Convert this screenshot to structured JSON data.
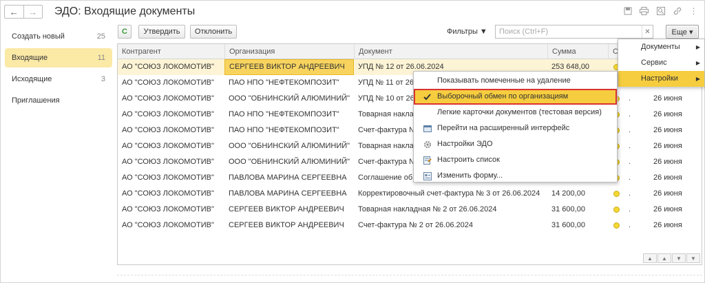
{
  "header": {
    "title": "ЭДО: Входящие документы",
    "back": "←",
    "forward": "→"
  },
  "sidebar": {
    "items": [
      {
        "label": "Создать новый",
        "count": "25"
      },
      {
        "label": "Входящие",
        "count": "11"
      },
      {
        "label": "Исходящие",
        "count": "3"
      },
      {
        "label": "Приглашения",
        "count": ""
      }
    ]
  },
  "toolbar": {
    "refresh": "C",
    "approve": "Утвердить",
    "reject": "Отклонить",
    "filters": "Фильтры ▼",
    "search_placeholder": "Поиск (Ctrl+F)",
    "more": "Еще ▾"
  },
  "table": {
    "columns": [
      "Контрагент",
      "Организация",
      "Документ",
      "Сумма",
      "С"
    ],
    "rows": [
      {
        "contractor": "АО \"СОЮЗ ЛОКОМОТИВ\"",
        "org": "СЕРГЕЕВ ВИКТОР АНДРЕЕВИЧ",
        "doc": "УПД № 12 от 26.06.2024",
        "sum": "253 648,00",
        "date": ""
      },
      {
        "contractor": "АО \"СОЮЗ ЛОКОМОТИВ\"",
        "org": "ПАО НПО \"НЕФТЕКОМПОЗИТ\"",
        "doc": "УПД № 11 от 26.06.2024",
        "sum": "",
        "date": ""
      },
      {
        "contractor": "АО \"СОЮЗ ЛОКОМОТИВ\"",
        "org": "ООО \"ОБНИНСКИЙ АЛЮМИНИЙ\"",
        "doc": "УПД № 10 от 26.06.2024",
        "sum": "",
        "date": "26 июня"
      },
      {
        "contractor": "АО \"СОЮЗ ЛОКОМОТИВ\"",
        "org": "ПАО НПО \"НЕФТЕКОМПОЗИТ\"",
        "doc": "Товарная накладная",
        "sum": "",
        "date": "26 июня"
      },
      {
        "contractor": "АО \"СОЮЗ ЛОКОМОТИВ\"",
        "org": "ПАО НПО \"НЕФТЕКОМПОЗИТ\"",
        "doc": "Счет-фактура № 5",
        "sum": "",
        "date": "26 июня"
      },
      {
        "contractor": "АО \"СОЮЗ ЛОКОМОТИВ\"",
        "org": "ООО \"ОБНИНСКИЙ АЛЮМИНИЙ\"",
        "doc": "Товарная накладная",
        "sum": "",
        "date": "26 июня"
      },
      {
        "contractor": "АО \"СОЮЗ ЛОКОМОТИВ\"",
        "org": "ООО \"ОБНИНСКИЙ АЛЮМИНИЙ\"",
        "doc": "Счет-фактура № 4",
        "sum": "",
        "date": "26 июня"
      },
      {
        "contractor": "АО \"СОЮЗ ЛОКОМОТИВ\"",
        "org": "ПАВЛОВА МАРИНА СЕРГЕЕВНА",
        "doc": "Соглашение об изменении",
        "sum": "",
        "date": "26 июня"
      },
      {
        "contractor": "АО \"СОЮЗ ЛОКОМОТИВ\"",
        "org": "ПАВЛОВА МАРИНА СЕРГЕЕВНА",
        "doc": "Корректировочный счет-фактура № 3 от 26.06.2024",
        "sum": "14 200,00",
        "date": "26 июня"
      },
      {
        "contractor": "АО \"СОЮЗ ЛОКОМОТИВ\"",
        "org": "СЕРГЕЕВ ВИКТОР АНДРЕЕВИЧ",
        "doc": "Товарная накладная № 2 от 26.06.2024",
        "sum": "31 600,00",
        "date": "26 июня"
      },
      {
        "contractor": "АО \"СОЮЗ ЛОКОМОТИВ\"",
        "org": "СЕРГЕЕВ ВИКТОР АНДРЕЕВИЧ",
        "doc": "Счет-фактура № 2 от 26.06.2024",
        "sum": "31 600,00",
        "date": "26 июня"
      }
    ]
  },
  "menu_more": {
    "items": [
      {
        "label": "Документы"
      },
      {
        "label": "Сервис"
      },
      {
        "label": "Настройки"
      }
    ]
  },
  "menu_settings": {
    "items": [
      {
        "label": "Показывать помеченные на удаление",
        "icon": ""
      },
      {
        "label": "Выборочный обмен по организациям",
        "icon": "check-icon"
      },
      {
        "label": "Легкие карточки документов (тестовая версия)",
        "icon": ""
      },
      {
        "label": "Перейти на расширенный интерфейс",
        "icon": "interface-icon"
      },
      {
        "label": "Настройки ЭДО",
        "icon": "gear-icon"
      },
      {
        "label": "Настроить список",
        "icon": "list-settings-icon"
      },
      {
        "label": "Изменить форму...",
        "icon": "form-icon"
      }
    ]
  },
  "colors": {
    "accent": "#f6cd3f",
    "selection": "#fdf4d6",
    "highlight_border": "#d9322f",
    "status_dot": "#f5d834"
  }
}
